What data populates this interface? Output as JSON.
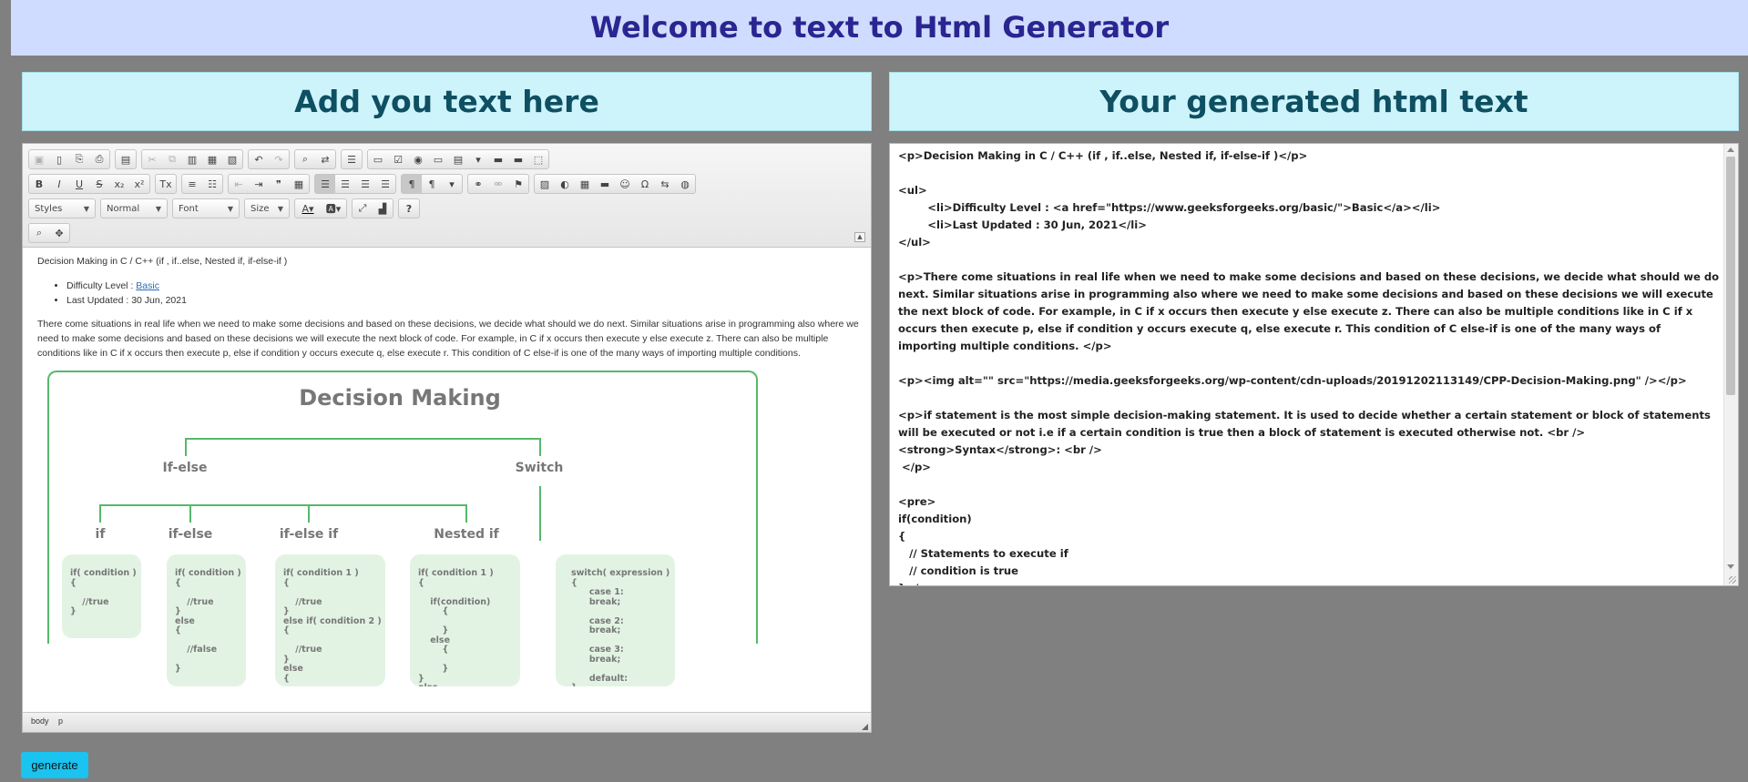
{
  "page": {
    "banner_title": "Welcome to text to Html Generator",
    "left_heading": "Add you text here",
    "right_heading": "Your generated html text",
    "generate_label": "generate"
  },
  "editor": {
    "toolbar_row1_icons": [
      "save-icon",
      "new-page-icon",
      "preview-icon",
      "print-icon",
      "templates-icon",
      "cut-icon",
      "copy-icon",
      "paste-icon",
      "paste-text-icon",
      "paste-word-icon",
      "undo-icon",
      "redo-icon",
      "find-icon",
      "replace-icon",
      "select-all-icon",
      "form-icon",
      "checkbox-icon",
      "radio-icon",
      "text-field-icon",
      "textarea-icon",
      "select-field-icon",
      "button-field-icon",
      "image-button-icon",
      "hidden-field-icon"
    ],
    "styles_combo": "Styles",
    "format_combo": "Normal",
    "font_combo": "Font",
    "size_combo": "Size",
    "help_label": "?",
    "status_body": "body",
    "status_p": "p",
    "content": {
      "heading": "Decision Making in C / C++ (if , if..else, Nested if, if-else-if )",
      "difficulty_prefix": "Difficulty Level : ",
      "difficulty_link": "Basic",
      "last_updated": "Last Updated : 30 Jun, 2021",
      "paragraph": "There come situations in real life when we need to make some decisions and based on these decisions, we decide what should we do next. Similar situations arise in programming also where we need to make some decisions and based on these decisions we will execute the next block of code. For example, in C if x occurs then execute y else execute z. There can also be multiple conditions like in C if x occurs then execute p, else if condition y occurs execute q, else execute r. This condition of C else-if is one of the many ways of importing multiple conditions."
    },
    "diagram": {
      "title": "Decision Making",
      "ifelse_label": "If-else",
      "switch_label": "Switch",
      "if_label": "if",
      "if_else_label": "if-else",
      "if_else_if_label": "if-else if",
      "nested_if_label": "Nested if",
      "code_if": "if( condition )\n{\n\n    //true\n}",
      "code_if_else": "if( condition )\n{\n\n    //true\n}\nelse\n{\n\n    //false\n\n}",
      "code_if_else_if": "if( condition 1 )\n{\n\n    //true\n}\nelse if( condition 2 )\n{\n\n    //true\n}\nelse\n{\n\n}",
      "code_nested_if": "if( condition 1 )\n{\n\n    if(condition)\n        {\n\n        }\n    else\n        {\n\n        }\n}\nelse\n{",
      "code_switch": "switch( expression )\n{\n      case 1:\n      break;\n\n      case 2:\n      break;\n\n      case 3:\n      break;\n\n      default:\n}"
    }
  },
  "output": {
    "text": "<p>Decision Making in C / C++ (if , if..else, Nested if, if-else-if )</p>\n\n<ul>\n\t<li>Difficulty Level : <a href=\"https://www.geeksforgeeks.org/basic/\">Basic</a></li>\n\t<li>Last Updated : 30 Jun, 2021</li>\n</ul>\n\n<p>There come situations in real life when we need to make some decisions and based on these decisions, we decide what should we do next. Similar situations arise in programming also where we need to make some decisions and based on these decisions we will execute the next block of code. For example, in C if x occurs then execute y else execute z. There can also be multiple conditions like in C if x occurs then execute p, else if condition y occurs execute q, else execute r. This condition of C else-if is one of the many ways of importing multiple conditions. </p>\n\n<p><img alt=\"\" src=\"https://media.geeksforgeeks.org/wp-content/cdn-uploads/20191202113149/CPP-Decision-Making.png\" /></p>\n\n<p>if statement is the most simple decision-making statement. It is used to decide whether a certain statement or block of statements will be executed or not i.e if a certain condition is true then a block of statement is executed otherwise not. <br />\n<strong>Syntax</strong>: <br />\n </p>\n\n<pre>\nif(condition) \n{\n   // Statements to execute if\n   // condition is true\n}</pre>"
  }
}
